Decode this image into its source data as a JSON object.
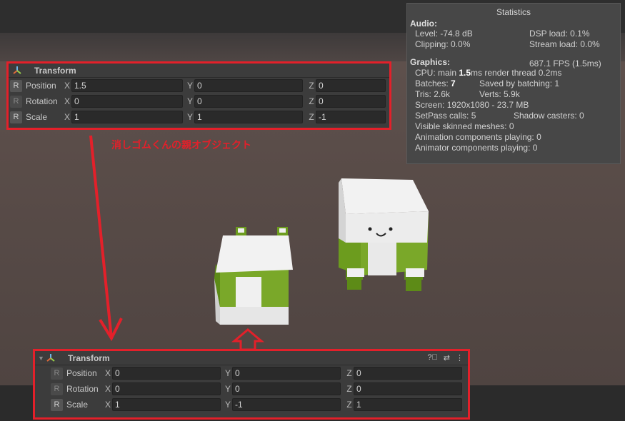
{
  "transform_top": {
    "title": "Transform",
    "rows": [
      {
        "label": "Position",
        "x": "1.5",
        "y": "0",
        "z": "0"
      },
      {
        "label": "Rotation",
        "x": "0",
        "y": "0",
        "z": "0"
      },
      {
        "label": "Scale",
        "x": "1",
        "y": "1",
        "z": "-1"
      }
    ]
  },
  "transform_bottom": {
    "title": "Transform",
    "rows": [
      {
        "label": "Position",
        "x": "0",
        "y": "0",
        "z": "0"
      },
      {
        "label": "Rotation",
        "x": "0",
        "y": "0",
        "z": "0"
      },
      {
        "label": "Scale",
        "x": "1",
        "y": "-1",
        "z": "1"
      }
    ]
  },
  "axes": {
    "x": "X",
    "y": "Y",
    "z": "Z",
    "r": "R"
  },
  "annotation": "消しゴムくんの親オブジェクト",
  "stats": {
    "title": "Statistics",
    "audio_heading": "Audio:",
    "level": "Level: -74.8 dB",
    "clipping": "Clipping: 0.0%",
    "dsp_load": "DSP load: 0.1%",
    "stream_load": "Stream load: 0.0%",
    "graphics_heading": "Graphics:",
    "fps": "687.1 FPS (1.5ms)",
    "cpu_main_prefix": "CPU: main",
    "cpu_main_value": "1.5",
    "cpu_main_suffix": "ms  render thread 0.2ms",
    "batches_prefix": "Batches:",
    "batches_value": "7",
    "saved_batching": "Saved by batching: 1",
    "tris": "Tris: 2.6k",
    "verts": "Verts: 5.9k",
    "screen": "Screen: 1920x1080 - 23.7 MB",
    "setpass": "SetPass calls: 5",
    "shadow_casters": "Shadow casters: 0",
    "skinned": "Visible skinned meshes: 0",
    "animation": "Animation components playing: 0",
    "animator": "Animator components playing: 0"
  }
}
